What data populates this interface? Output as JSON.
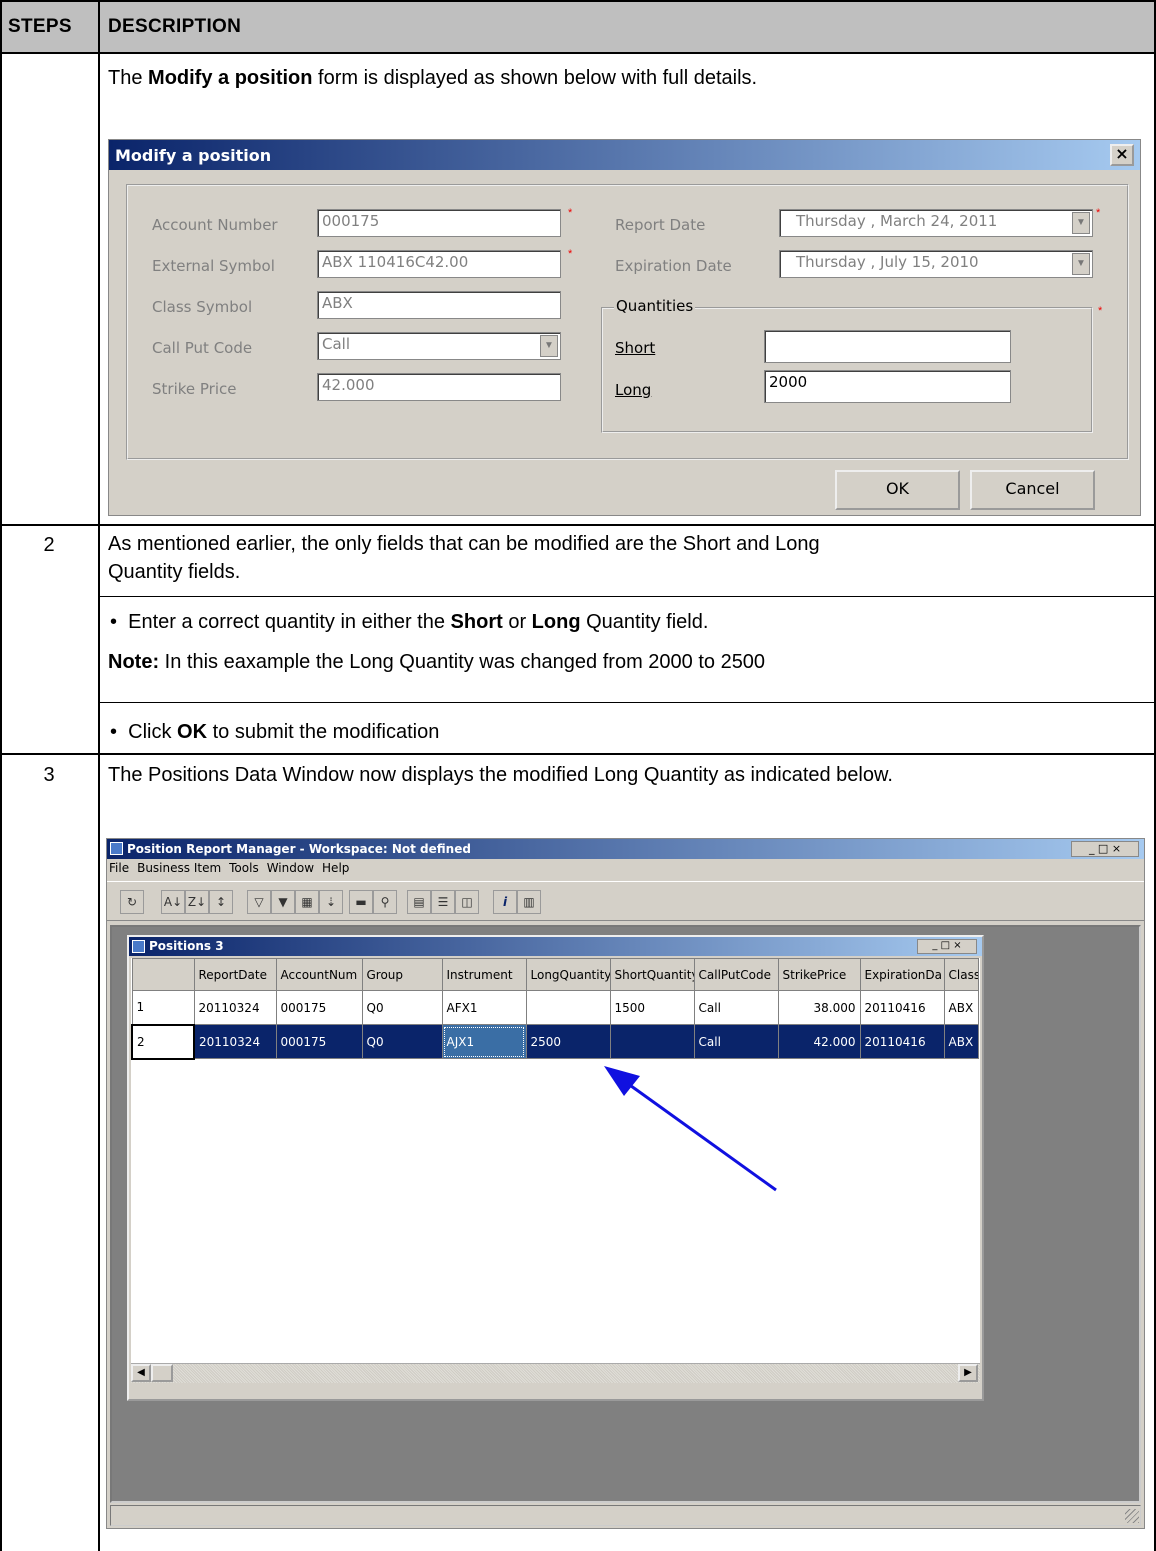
{
  "header": {
    "steps": "STEPS",
    "description": "DESCRIPTION"
  },
  "step1": {
    "text_pre": "The ",
    "text_bold": "Modify a position",
    "text_post": " form is displayed as shown below with full details."
  },
  "dialog": {
    "title": "Modify a position",
    "close": "×",
    "fields": {
      "account_label": "Account Number",
      "account_value": "000175",
      "external_label": "External Symbol",
      "external_value": "ABX  110416C42.00",
      "class_label": "Class Symbol",
      "class_value": "ABX",
      "callput_label": "Call Put Code",
      "callput_value": "Call",
      "strike_label": "Strike Price",
      "strike_value": "42.000",
      "report_label": "Report Date",
      "report_value": "Thursday ,   March   24, 2011",
      "expiration_label": "Expiration Date",
      "expiration_value": "Thursday ,     July    15, 2010",
      "quantities_label": "Quantities",
      "short_label": "Short",
      "short_value": "",
      "long_label": "Long",
      "long_value": "2000"
    },
    "ok": "OK",
    "cancel": "Cancel",
    "required_mark": "*"
  },
  "step2": {
    "number": "2",
    "line1": "As mentioned earlier, the only fields that can be modified are the Short and Long",
    "line2": "Quantity fields.",
    "bullet1_pre": "Enter a correct quantity in either the ",
    "bullet1_b1": "Short",
    "bullet1_mid": " or ",
    "bullet1_b2": "Long",
    "bullet1_post": " Quantity field.",
    "note_label": "Note:",
    "note_text": " In this eaxample the Long Quantity was changed from 2000 to 2500",
    "bullet2_pre": "Click ",
    "bullet2_b": "OK",
    "bullet2_post": " to submit the modification",
    "bullet": "•"
  },
  "step3": {
    "number": "3",
    "text": "The Positions Data Window now displays the modified Long Quantity as indicated below."
  },
  "app": {
    "title": "Position Report Manager - Workspace: Not defined",
    "menu": [
      "File",
      "Business Item",
      "Tools",
      "Window",
      "Help"
    ],
    "child_title": "Positions 3",
    "columns": [
      "",
      "ReportDate",
      "AccountNum",
      "Group",
      "Instrument",
      "LongQuantity",
      "ShortQuantity",
      "CallPutCode",
      "StrikePrice",
      "ExpirationDa",
      "Class"
    ],
    "rows": [
      [
        "1",
        "20110324",
        "000175",
        "Q0",
        "AFX1",
        "",
        "1500",
        "Call",
        "38.000",
        "20110416",
        "ABX"
      ],
      [
        "2",
        "20110324",
        "000175",
        "Q0",
        "AJX1",
        "2500",
        "",
        "Call",
        "42.000",
        "20110416",
        "ABX"
      ]
    ],
    "win_buttons": "_ □ ×"
  }
}
